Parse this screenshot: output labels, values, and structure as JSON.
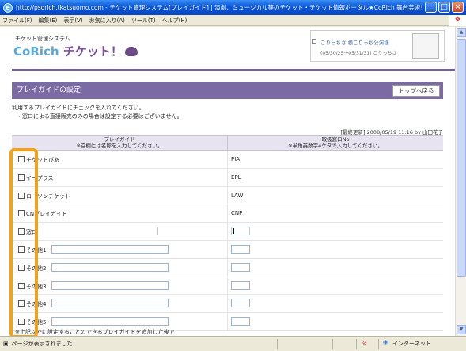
{
  "window": {
    "title": "http://psorich.tkatsuomo.com - チケット管理システム[プレイガイド] | 演劇、ミュージカル等のチケット・チケット情報ポータル★CoRich 舞台芸術！ - Microsoft I...",
    "minimize": "_",
    "maximize": "□",
    "close": "×"
  },
  "menu": [
    "ファイル(F)",
    "編集(E)",
    "表示(V)",
    "お気に入り(A)",
    "ツール(T)",
    "ヘルプ(H)"
  ],
  "header": {
    "system_name": "チケット管理システム",
    "logo_co": "Co",
    "logo_rich": "Rich",
    "logo_ticket": " チケット！",
    "login_line1": "こりっちさ  様こりっち公演様",
    "login_line2": "(05/30/25〜05/31/31)  こりっちさ"
  },
  "section": {
    "title": "プレイガイドの設定",
    "back_button": "トップへ戻る"
  },
  "instructions": {
    "line1": "利用するプレイガイドにチェックを入れてください。",
    "line2": "・窓口による直接販売のみの場合は設定する必要はございません。"
  },
  "last_updated": "[最終更新] 2008/05/19 11:16 by 山田花子",
  "table": {
    "header_col1_line1": "プレイガイド",
    "header_col1_line2": "※空欄には名称を入力してください。",
    "header_col2_line1": "取扱窓口No",
    "header_col2_line2": "※半角英数字4ケタで入力してください。",
    "rows": [
      {
        "name": "チケットぴあ",
        "code": "PIA"
      },
      {
        "name": "イープラス",
        "code": "EPL"
      },
      {
        "name": "ローソンチケット",
        "code": "LAW"
      },
      {
        "name": "CNプレイガイド",
        "code": "CNP"
      },
      {
        "name": "窓口",
        "code": ""
      },
      {
        "name": "その他1",
        "code": ""
      },
      {
        "name": "その他2",
        "code": ""
      },
      {
        "name": "その他3",
        "code": ""
      },
      {
        "name": "その他4",
        "code": ""
      },
      {
        "name": "その他5",
        "code": ""
      }
    ]
  },
  "footnote": "※上記以外に設定することのできるプレイガイドを追加した後で",
  "status": {
    "text": "ページが表示されました",
    "zone": "インターネット"
  },
  "colors": {
    "accent_purple": "#7b6aa3",
    "highlight_orange": "#f4a11a",
    "titlebar_blue": "#0a56d8"
  }
}
